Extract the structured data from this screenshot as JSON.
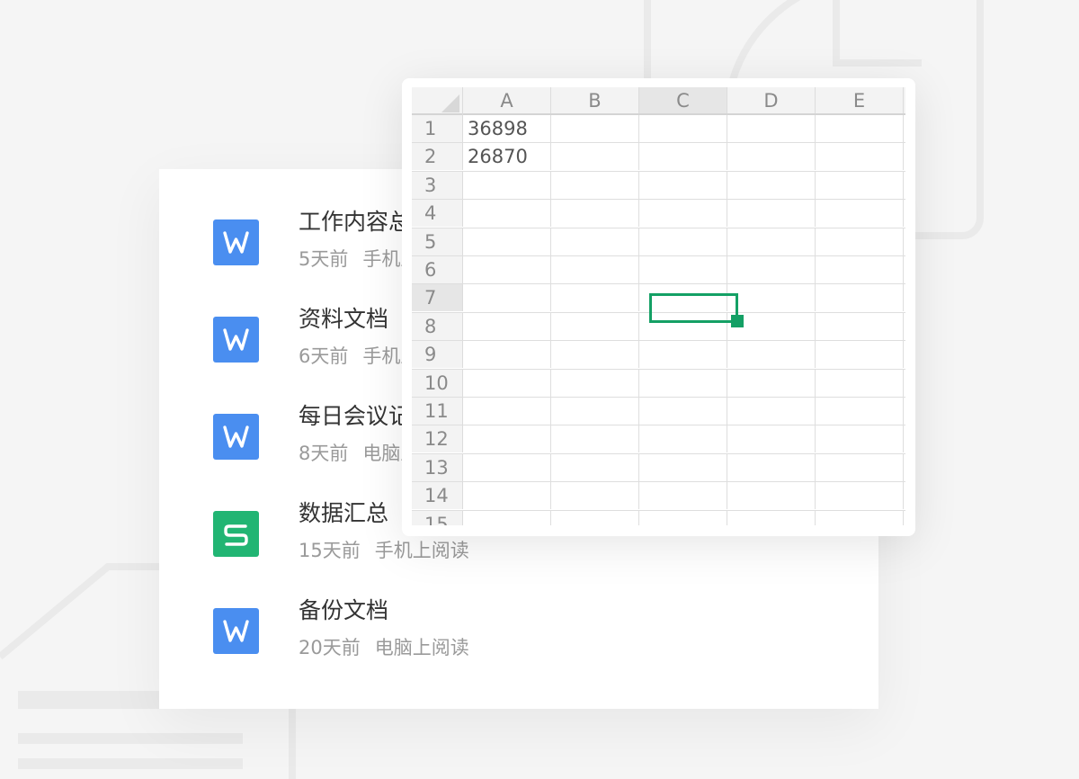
{
  "colors": {
    "writer_icon": "#4a8ef0",
    "sheet_icon": "#21b573",
    "selection": "#14a065"
  },
  "files": [
    {
      "name": "工作内容总结",
      "time": "5天前",
      "source": "手机上阅读",
      "icon": "writer-icon"
    },
    {
      "name": "资料文档",
      "time": "6天前",
      "source": "手机上阅读",
      "icon": "writer-icon"
    },
    {
      "name": "每日会议记录",
      "time": "8天前",
      "source": "电脑上阅读",
      "icon": "writer-icon"
    },
    {
      "name": "数据汇总",
      "time": "15天前",
      "source": "手机上阅读",
      "icon": "sheet-icon"
    },
    {
      "name": "备份文档",
      "time": "20天前",
      "source": "电脑上阅读",
      "icon": "writer-icon"
    }
  ],
  "sheet": {
    "columns": [
      "A",
      "B",
      "C",
      "D",
      "E"
    ],
    "rows": [
      "1",
      "2",
      "3",
      "4",
      "5",
      "6",
      "7",
      "8",
      "9",
      "10",
      "11",
      "12",
      "13",
      "14",
      "15"
    ],
    "cells": {
      "A1": "36898",
      "A2": "26870"
    },
    "selected_cell": "C7"
  }
}
